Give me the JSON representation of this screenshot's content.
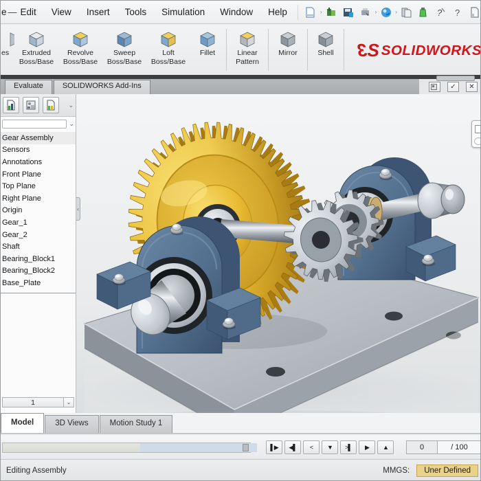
{
  "menu_bar": {
    "partial_item": "e",
    "dash": "—",
    "items": [
      "Edit",
      "View",
      "Insert",
      "Tools",
      "Simulation",
      "Window",
      "Help"
    ]
  },
  "quick_toolbar": {
    "icons": [
      "new-document",
      "open-document",
      "save",
      "print",
      "rebuild",
      "file-properties",
      "measure",
      "whats-wrong",
      "help",
      "options",
      "partial"
    ]
  },
  "ribbon": {
    "partial_label": "es",
    "buttons": [
      {
        "l1": "Extruded",
        "l2": "Boss/Base",
        "icon": {
          "top": "#e6eaec",
          "left": "#9fb6c9",
          "right": "#c8d5de"
        }
      },
      {
        "l1": "Revolve",
        "l2": "Boss/Base",
        "icon": {
          "top": "#f0d05a",
          "left": "#7fa8cf",
          "right": "#abc7e0"
        }
      },
      {
        "l1": "Sweep",
        "l2": "Boss/Base",
        "icon": {
          "top": "#9db9d6",
          "left": "#5b87b4",
          "right": "#7da3c8"
        }
      },
      {
        "l1": "Loft",
        "l2": "Boss/Base",
        "icon": {
          "top": "#f0d05a",
          "left": "#7fa8cf",
          "right": "#e2bf4e"
        }
      },
      {
        "l1": "Fillet",
        "l2": "",
        "icon": {
          "top": "#a8c4de",
          "left": "#6f9cc4",
          "right": "#8fb3d4"
        }
      },
      {
        "l1": "Linear",
        "l2": "Pattern",
        "icon": {
          "top": "#f0d05a",
          "left": "#b0b7bd",
          "right": "#d2d7db"
        }
      },
      {
        "l1": "Mirror",
        "l2": "",
        "icon": {
          "top": "#c9ced3",
          "left": "#8e969d",
          "right": "#aab2b9"
        }
      },
      {
        "l1": "Shell",
        "l2": "",
        "icon": {
          "top": "#c9ced3",
          "left": "#878f96",
          "right": "#a5adb4"
        }
      }
    ]
  },
  "logo": {
    "mark_digit": "3",
    "mark_letter": "S",
    "text": "SOLIDWORKS"
  },
  "command_tabs": {
    "items": [
      "Evaluate",
      "SOLIDWORKS Add-Ins"
    ]
  },
  "viewport_buttons": {
    "confirm": "✓",
    "close": "✕"
  },
  "feature_tree": {
    "items": [
      "Gear Assembly",
      "Sensors",
      "Annotations",
      "Front Plane",
      "Top Plane",
      "Right Plane",
      "Origin",
      "Gear_1",
      "Gear_2",
      "Shaft",
      "Bearing_Block1",
      "Bearing_Block2",
      "Base_Plate"
    ],
    "config_value": "1"
  },
  "bottom_tabs": {
    "items": [
      "Model",
      "3D Views",
      "Motion Study 1"
    ],
    "active": "Model"
  },
  "playback": {
    "buttons": [
      "▌▶",
      "◀▌",
      "<",
      "▼",
      ">▌",
      "▶",
      "▲"
    ],
    "frame_current": "0",
    "frame_total": "/ 100"
  },
  "status_bar": {
    "left": "Editing Assembly",
    "units_label": "MMGS:",
    "state_badge": "Uner Defined"
  },
  "icons": {
    "chevron_down": "⌄",
    "caret_right": "›"
  },
  "colors": {
    "logo_red": "#D0161B",
    "badge_bg": "#EAD28B",
    "badge_border": "#C2A24E",
    "gear_yellow": "#E9BC34",
    "gear_shadow": "#A87C12",
    "block_blue": "#53708E",
    "block_dark": "#3D5473",
    "steel_light": "#EEF1F4",
    "steel_dark": "#51585F",
    "bronze": "#C8A96E",
    "plate_top": "#B9BFC5",
    "plate_front": "#8B9299",
    "bg_top": "#F4F5F6",
    "bg_bottom": "#DCDFE1"
  }
}
